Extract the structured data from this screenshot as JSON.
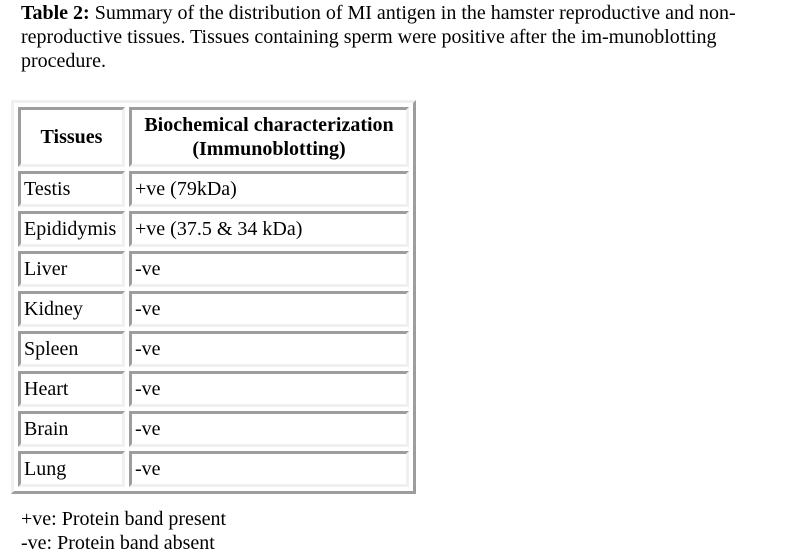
{
  "caption": {
    "label": "Table 2:",
    "text": " Summary of the distribution of MI antigen in the hamster reproductive and non-reproductive tissues. Tissues containing sperm were positive after the im-munoblotting procedure."
  },
  "table": {
    "headers": {
      "tissues": "Tissues",
      "biochemical_line1": "Biochemical characterization",
      "biochemical_line2": "(Immunoblotting)"
    },
    "rows": [
      {
        "tissue": "Testis",
        "result": "+ve (79kDa)"
      },
      {
        "tissue": "Epididymis",
        "result": "+ve (37.5 & 34 kDa)"
      },
      {
        "tissue": "Liver",
        "result": "-ve"
      },
      {
        "tissue": "Kidney",
        "result": "-ve"
      },
      {
        "tissue": "Spleen",
        "result": "-ve"
      },
      {
        "tissue": "Heart",
        "result": "-ve"
      },
      {
        "tissue": "Brain",
        "result": "-ve"
      },
      {
        "tissue": "Lung",
        "result": "-ve"
      }
    ]
  },
  "footnotes": [
    "+ve: Protein band present",
    "-ve: Protein band absent"
  ]
}
